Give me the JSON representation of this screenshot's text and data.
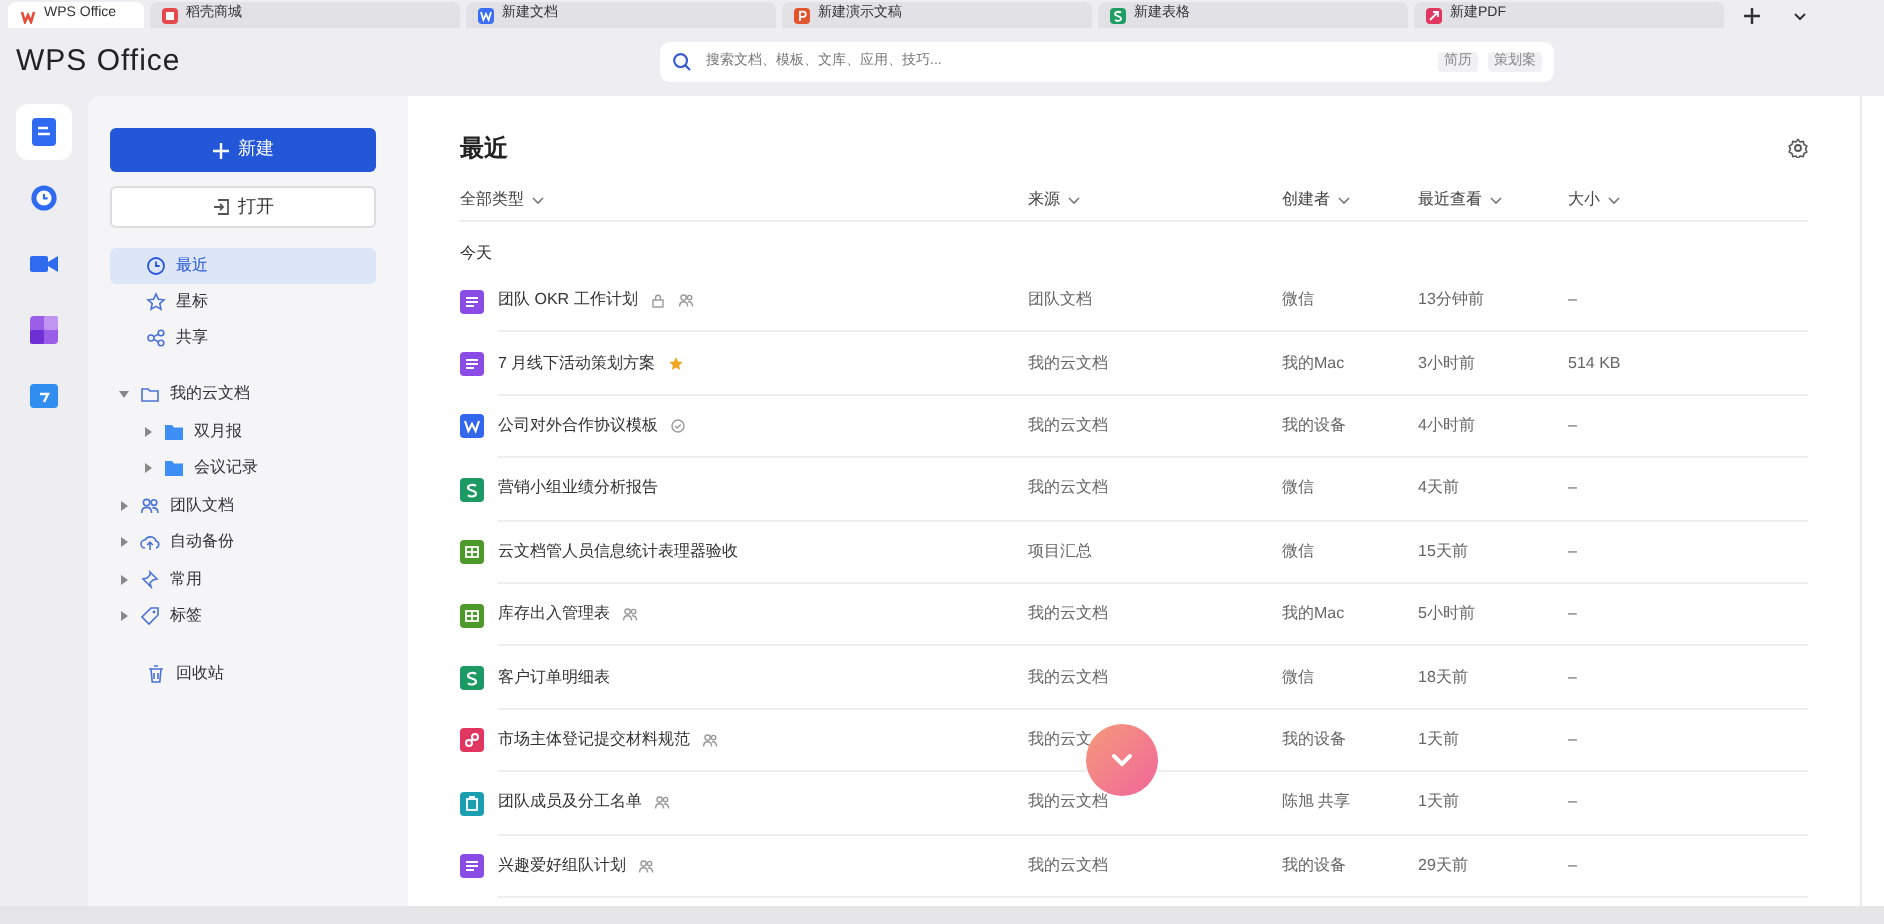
{
  "tabs": [
    {
      "label": "WPS Office",
      "kind": "wps",
      "selected": true
    },
    {
      "label": "稻壳商城",
      "kind": "store",
      "selected": false
    },
    {
      "label": "新建文档",
      "kind": "word",
      "selected": false
    },
    {
      "label": "新建演示文稿",
      "kind": "ppt",
      "selected": false
    },
    {
      "label": "新建表格",
      "kind": "sheet",
      "selected": false
    },
    {
      "label": "新建PDF",
      "kind": "pdf",
      "selected": false
    }
  ],
  "app_title": "WPS Office",
  "search": {
    "placeholder": "搜索文档、模板、文库、应用、技巧...",
    "chips": [
      "简历",
      "策划案"
    ]
  },
  "rail": [
    {
      "kind": "docs",
      "selected": true
    },
    {
      "kind": "clock",
      "selected": false
    },
    {
      "kind": "meeting",
      "selected": false
    },
    {
      "kind": "apps",
      "selected": false
    },
    {
      "kind": "calendar",
      "selected": false
    }
  ],
  "new_button": "新建",
  "open_button": "打开",
  "nav": [
    {
      "label": "最近",
      "kind": "clock",
      "selected": true
    },
    {
      "label": "星标",
      "kind": "star",
      "selected": false
    },
    {
      "label": "共享",
      "kind": "share",
      "selected": false
    }
  ],
  "tree": [
    {
      "label": "我的云文档",
      "kind": "cloudfolder",
      "expanded": true,
      "children": [
        {
          "label": "双月报",
          "kind": "folder",
          "expanded": false
        },
        {
          "label": "会议记录",
          "kind": "folder",
          "expanded": false
        }
      ]
    },
    {
      "label": "团队文档",
      "kind": "team",
      "expanded": false
    },
    {
      "label": "自动备份",
      "kind": "backup",
      "expanded": false
    },
    {
      "label": "常用",
      "kind": "pin",
      "expanded": false
    },
    {
      "label": "标签",
      "kind": "tag",
      "expanded": false
    }
  ],
  "trash": "回收站",
  "main": {
    "title": "最近",
    "columns": [
      "全部类型",
      "来源",
      "创建者",
      "最近查看",
      "大小"
    ],
    "group": "今天",
    "rows": [
      {
        "name": "团队 OKR 工作计划",
        "kind": "note",
        "locked": true,
        "shared": true,
        "starred": false,
        "verified": false,
        "source": "团队文档",
        "creator": "微信",
        "viewed": "13分钟前",
        "size": "–"
      },
      {
        "name": "7 月线下活动策划方案",
        "kind": "note",
        "locked": false,
        "shared": false,
        "starred": true,
        "verified": false,
        "source": "我的云文档",
        "creator": "我的Mac",
        "viewed": "3小时前",
        "size": "514 KB"
      },
      {
        "name": "公司对外合作协议模板",
        "kind": "word",
        "locked": false,
        "shared": false,
        "starred": false,
        "verified": true,
        "source": "我的云文档",
        "creator": "我的设备",
        "viewed": "4小时前",
        "size": "–"
      },
      {
        "name": "营销小组业绩分析报告",
        "kind": "sheet",
        "locked": false,
        "shared": false,
        "starred": false,
        "verified": false,
        "source": "我的云文档",
        "creator": "微信",
        "viewed": "4天前",
        "size": "–"
      },
      {
        "name": "云文档管人员信息统计表理器验收",
        "kind": "table",
        "locked": false,
        "shared": false,
        "starred": false,
        "verified": false,
        "source": "项目汇总",
        "creator": "微信",
        "viewed": "15天前",
        "size": "–"
      },
      {
        "name": "库存出入管理表",
        "kind": "table",
        "locked": false,
        "shared": true,
        "starred": false,
        "verified": false,
        "source": "我的云文档",
        "creator": "我的Mac",
        "viewed": "5小时前",
        "size": "–"
      },
      {
        "name": "客户订单明细表",
        "kind": "sheet",
        "locked": false,
        "shared": false,
        "starred": false,
        "verified": false,
        "source": "我的云文档",
        "creator": "微信",
        "viewed": "18天前",
        "size": "–"
      },
      {
        "name": "市场主体登记提交材料规范",
        "kind": "pdf",
        "locked": false,
        "shared": true,
        "starred": false,
        "verified": false,
        "source": "我的云文",
        "creator": "我的设备",
        "viewed": "1天前",
        "size": "–"
      },
      {
        "name": "团队成员及分工名单",
        "kind": "form",
        "locked": false,
        "shared": true,
        "starred": false,
        "verified": false,
        "source": "我的云文档",
        "creator": "陈旭 共享",
        "viewed": "1天前",
        "size": "–"
      },
      {
        "name": "兴趣爱好组队计划",
        "kind": "note",
        "locked": false,
        "shared": true,
        "starred": false,
        "verified": false,
        "source": "我的云文档",
        "creator": "我的设备",
        "viewed": "29天前",
        "size": "–"
      }
    ]
  }
}
